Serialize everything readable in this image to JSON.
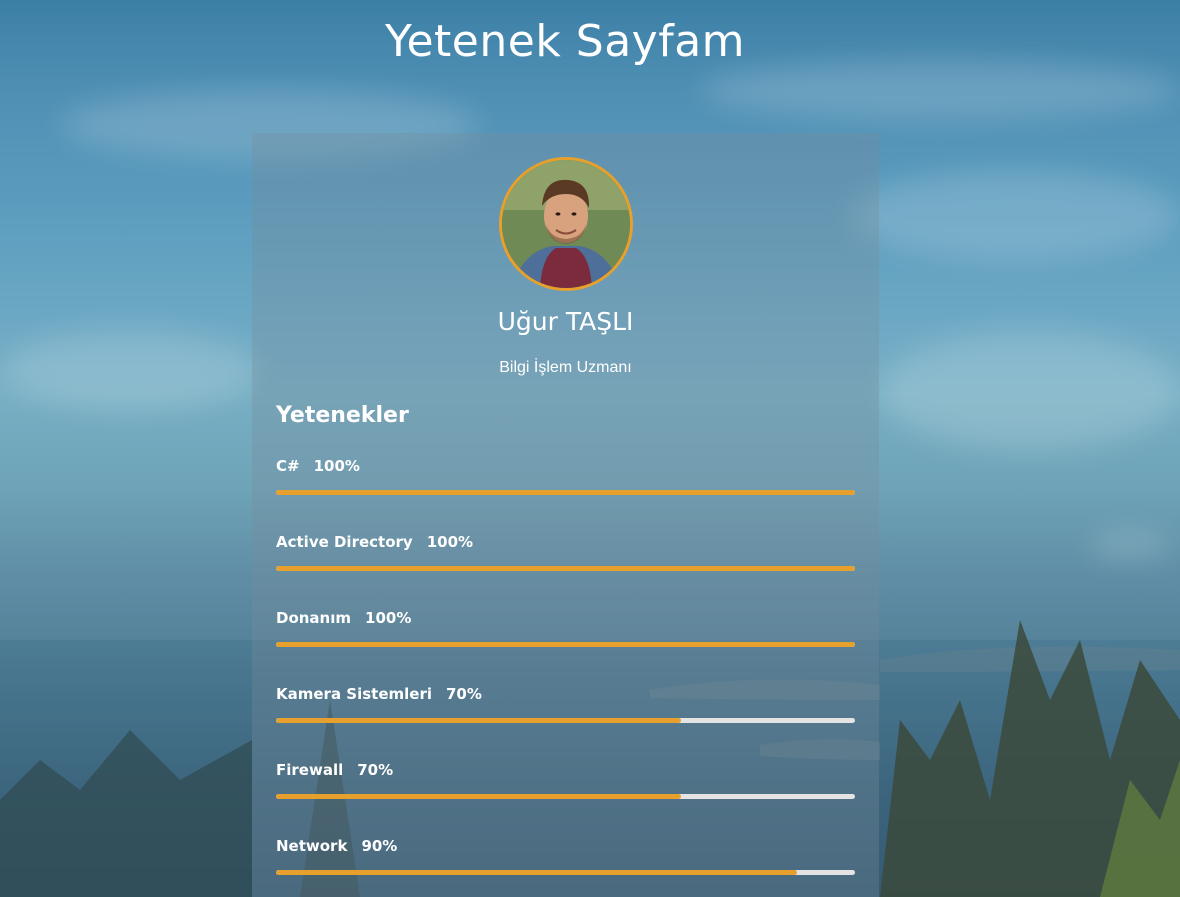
{
  "page": {
    "title": "Yetenek Sayfam"
  },
  "profile": {
    "name": "Uğur TAŞLI",
    "role": "Bilgi İşlem Uzmanı"
  },
  "skills_section": {
    "title": "Yetenekler",
    "items": [
      {
        "label": "C#",
        "percent_text": "100%",
        "level": 100
      },
      {
        "label": "Active Directory",
        "percent_text": "100%",
        "level": 100
      },
      {
        "label": "Donanım",
        "percent_text": "100%",
        "level": 100
      },
      {
        "label": "Kamera Sistemleri",
        "percent_text": "70%",
        "level": 70
      },
      {
        "label": "Firewall",
        "percent_text": "70%",
        "level": 70
      },
      {
        "label": "Network",
        "percent_text": "90%",
        "level": 90
      }
    ]
  },
  "colors": {
    "accent": "#e8a02c",
    "track": "#e4e4e4",
    "text": "#ffffff"
  }
}
